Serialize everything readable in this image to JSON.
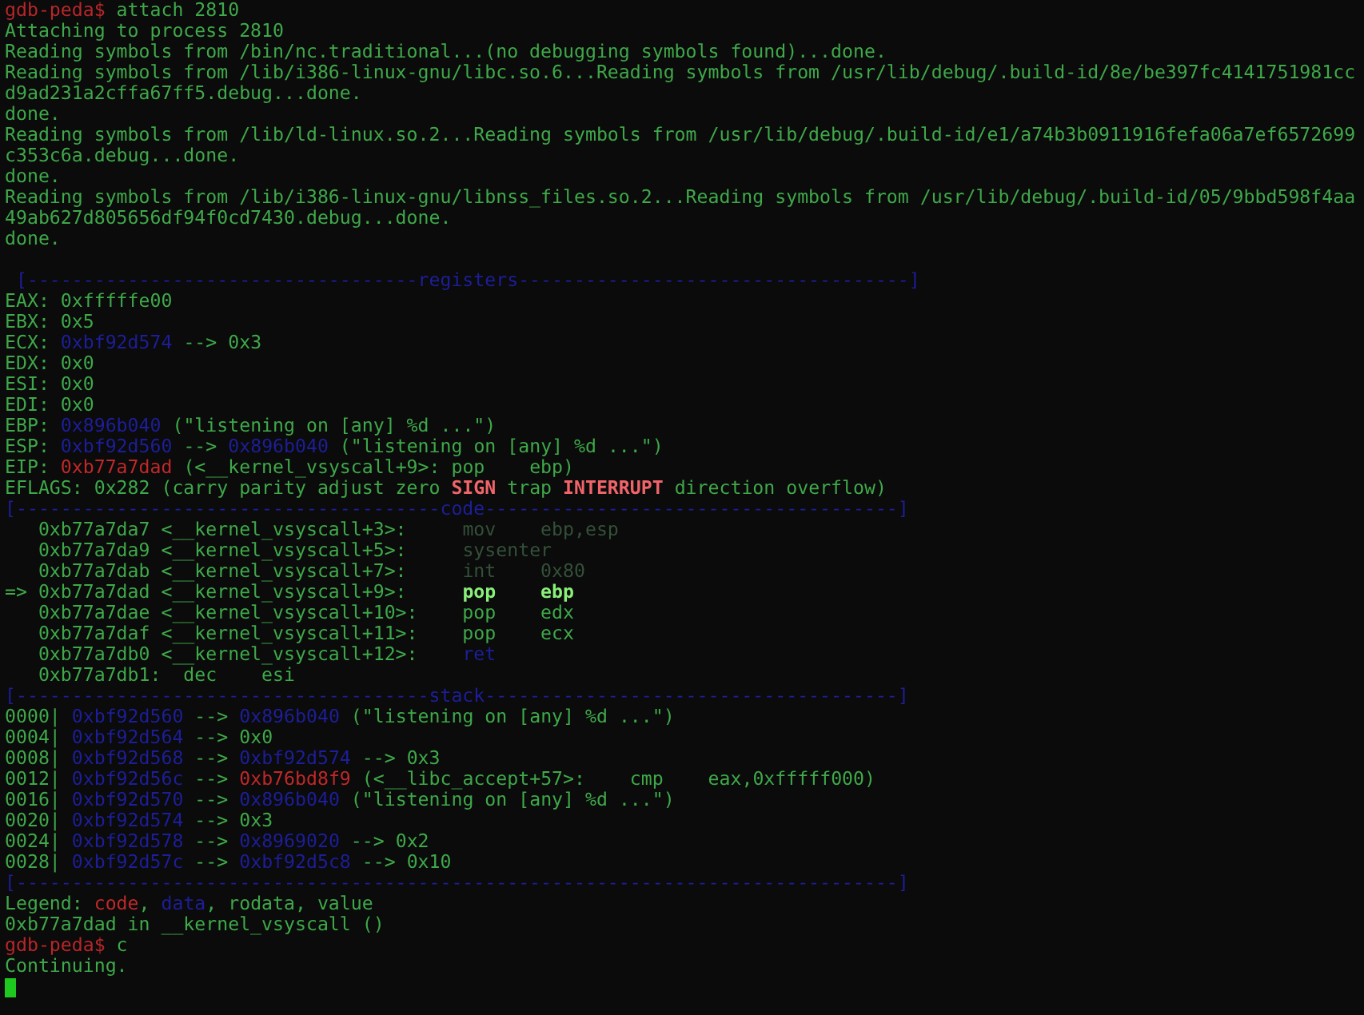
{
  "terminal": {
    "lines": [
      [
        {
          "text": "gdb-peda$",
          "kind": "prompt"
        },
        {
          "text": " attach 2810",
          "kind": "plain"
        }
      ],
      [
        {
          "text": "Attaching to process 2810",
          "kind": "plain"
        }
      ],
      [
        {
          "text": "Reading symbols from /bin/nc.traditional...(no debugging symbols found)...done.",
          "kind": "plain"
        }
      ],
      [
        {
          "text": "Reading symbols from /lib/i386-linux-gnu/libc.so.6...Reading symbols from /usr/lib/debug/.build-id/8e/be397fc4141751981cc",
          "kind": "plain"
        }
      ],
      [
        {
          "text": "d9ad231a2cffa67ff5.debug...done.",
          "kind": "plain"
        }
      ],
      [
        {
          "text": "done.",
          "kind": "plain"
        }
      ],
      [
        {
          "text": "Reading symbols from /lib/ld-linux.so.2...Reading symbols from /usr/lib/debug/.build-id/e1/a74b3b0911916fefa06a7ef6572699",
          "kind": "plain"
        }
      ],
      [
        {
          "text": "c353c6a.debug...done.",
          "kind": "plain"
        }
      ],
      [
        {
          "text": "done.",
          "kind": "plain"
        }
      ],
      [
        {
          "text": "Reading symbols from /lib/i386-linux-gnu/libnss_files.so.2...Reading symbols from /usr/lib/debug/.build-id/05/9bbd598f4aa",
          "kind": "plain"
        }
      ],
      [
        {
          "text": "49ab627d805656df94f0cd7430.debug...done.",
          "kind": "plain"
        }
      ],
      [
        {
          "text": "done.",
          "kind": "plain"
        }
      ],
      [
        {
          "text": " [-----------------------------------registers-----------------------------------]",
          "kind": "rule",
          "gap_before": true
        }
      ],
      [
        {
          "text": "EAX: 0xfffffe00",
          "kind": "plain"
        }
      ],
      [
        {
          "text": "EBX: 0x5",
          "kind": "plain"
        }
      ],
      [
        {
          "text": "ECX: ",
          "kind": "plain"
        },
        {
          "text": "0xbf92d574",
          "kind": "data"
        },
        {
          "text": " --> 0x3",
          "kind": "plain"
        }
      ],
      [
        {
          "text": "EDX: 0x0",
          "kind": "plain"
        }
      ],
      [
        {
          "text": "ESI: 0x0",
          "kind": "plain"
        }
      ],
      [
        {
          "text": "EDI: 0x0",
          "kind": "plain"
        }
      ],
      [
        {
          "text": "EBP: ",
          "kind": "plain"
        },
        {
          "text": "0x896b040",
          "kind": "data"
        },
        {
          "text": " (\"listening on [any] %d ...\")",
          "kind": "plain"
        }
      ],
      [
        {
          "text": "ESP: ",
          "kind": "plain"
        },
        {
          "text": "0xbf92d560",
          "kind": "data"
        },
        {
          "text": " --> ",
          "kind": "plain"
        },
        {
          "text": "0x896b040",
          "kind": "data"
        },
        {
          "text": " (\"listening on [any] %d ...\")",
          "kind": "plain"
        }
      ],
      [
        {
          "text": "EIP: ",
          "kind": "plain"
        },
        {
          "text": "0xb77a7dad",
          "kind": "code"
        },
        {
          "text": " (<__kernel_vsyscall+9>: pop    ebp)",
          "kind": "plain"
        }
      ],
      [
        {
          "text": "EFLAGS: 0x282 (carry parity adjust zero ",
          "kind": "plain"
        },
        {
          "text": "SIGN",
          "kind": "flag"
        },
        {
          "text": " trap ",
          "kind": "plain"
        },
        {
          "text": "INTERRUPT",
          "kind": "flag"
        },
        {
          "text": " direction overflow)",
          "kind": "plain"
        }
      ],
      [
        {
          "text": "[--------------------------------------code-------------------------------------]",
          "kind": "rule"
        }
      ],
      [
        {
          "text": "   0xb77a7da7 <__kernel_vsyscall+3>:     ",
          "kind": "plain"
        },
        {
          "text": "mov    ebp,esp",
          "kind": "dim"
        }
      ],
      [
        {
          "text": "   0xb77a7da9 <__kernel_vsyscall+5>:     ",
          "kind": "plain"
        },
        {
          "text": "sysenter",
          "kind": "dim"
        }
      ],
      [
        {
          "text": "   0xb77a7dab <__kernel_vsyscall+7>:     ",
          "kind": "plain"
        },
        {
          "text": "int    0x80",
          "kind": "dim"
        }
      ],
      [
        {
          "text": "=> 0xb77a7dad <__kernel_vsyscall+9>:     ",
          "kind": "plain"
        },
        {
          "text": "pop    ebp",
          "kind": "current"
        }
      ],
      [
        {
          "text": "   0xb77a7dae <__kernel_vsyscall+10>:    pop    edx",
          "kind": "plain"
        }
      ],
      [
        {
          "text": "   0xb77a7daf <__kernel_vsyscall+11>:    pop    ecx",
          "kind": "plain"
        }
      ],
      [
        {
          "text": "   0xb77a7db0 <__kernel_vsyscall+12>:    ",
          "kind": "plain"
        },
        {
          "text": "ret",
          "kind": "data"
        }
      ],
      [
        {
          "text": "   0xb77a7db1:  dec    esi",
          "kind": "plain"
        }
      ],
      [
        {
          "text": "[-------------------------------------stack-------------------------------------]",
          "kind": "rule"
        }
      ],
      [
        {
          "text": "0000| ",
          "kind": "plain"
        },
        {
          "text": "0xbf92d560",
          "kind": "data"
        },
        {
          "text": " --> ",
          "kind": "plain"
        },
        {
          "text": "0x896b040",
          "kind": "data"
        },
        {
          "text": " (\"listening on [any] %d ...\")",
          "kind": "plain"
        }
      ],
      [
        {
          "text": "0004| ",
          "kind": "plain"
        },
        {
          "text": "0xbf92d564",
          "kind": "data"
        },
        {
          "text": " --> 0x0",
          "kind": "plain"
        }
      ],
      [
        {
          "text": "0008| ",
          "kind": "plain"
        },
        {
          "text": "0xbf92d568",
          "kind": "data"
        },
        {
          "text": " --> ",
          "kind": "plain"
        },
        {
          "text": "0xbf92d574",
          "kind": "data"
        },
        {
          "text": " --> 0x3",
          "kind": "plain"
        }
      ],
      [
        {
          "text": "0012| ",
          "kind": "plain"
        },
        {
          "text": "0xbf92d56c",
          "kind": "data"
        },
        {
          "text": " --> ",
          "kind": "plain"
        },
        {
          "text": "0xb76bd8f9",
          "kind": "code"
        },
        {
          "text": " (<__libc_accept+57>:    cmp    eax,0xfffff000)",
          "kind": "plain"
        }
      ],
      [
        {
          "text": "0016| ",
          "kind": "plain"
        },
        {
          "text": "0xbf92d570",
          "kind": "data"
        },
        {
          "text": " --> ",
          "kind": "plain"
        },
        {
          "text": "0x896b040",
          "kind": "data"
        },
        {
          "text": " (\"listening on [any] %d ...\")",
          "kind": "plain"
        }
      ],
      [
        {
          "text": "0020| ",
          "kind": "plain"
        },
        {
          "text": "0xbf92d574",
          "kind": "data"
        },
        {
          "text": " --> 0x3",
          "kind": "plain"
        }
      ],
      [
        {
          "text": "0024| ",
          "kind": "plain"
        },
        {
          "text": "0xbf92d578",
          "kind": "data"
        },
        {
          "text": " --> ",
          "kind": "plain"
        },
        {
          "text": "0x8969020",
          "kind": "data"
        },
        {
          "text": " --> 0x2",
          "kind": "plain"
        }
      ],
      [
        {
          "text": "0028| ",
          "kind": "plain"
        },
        {
          "text": "0xbf92d57c",
          "kind": "data"
        },
        {
          "text": " --> ",
          "kind": "plain"
        },
        {
          "text": "0xbf92d5c8",
          "kind": "data"
        },
        {
          "text": " --> 0x10",
          "kind": "plain"
        }
      ],
      [
        {
          "text": "[-------------------------------------------------------------------------------]",
          "kind": "rule"
        }
      ],
      [
        {
          "text": "Legend: ",
          "kind": "plain"
        },
        {
          "text": "code",
          "kind": "code"
        },
        {
          "text": ", ",
          "kind": "plain"
        },
        {
          "text": "data",
          "kind": "data"
        },
        {
          "text": ", rodata, value",
          "kind": "plain"
        }
      ],
      [
        {
          "text": "0xb77a7dad in __kernel_vsyscall ()",
          "kind": "plain"
        }
      ],
      [
        {
          "text": "gdb-peda$",
          "kind": "prompt"
        },
        {
          "text": " c",
          "kind": "plain"
        }
      ],
      [
        {
          "text": "Continuing.",
          "kind": "plain"
        }
      ]
    ]
  }
}
